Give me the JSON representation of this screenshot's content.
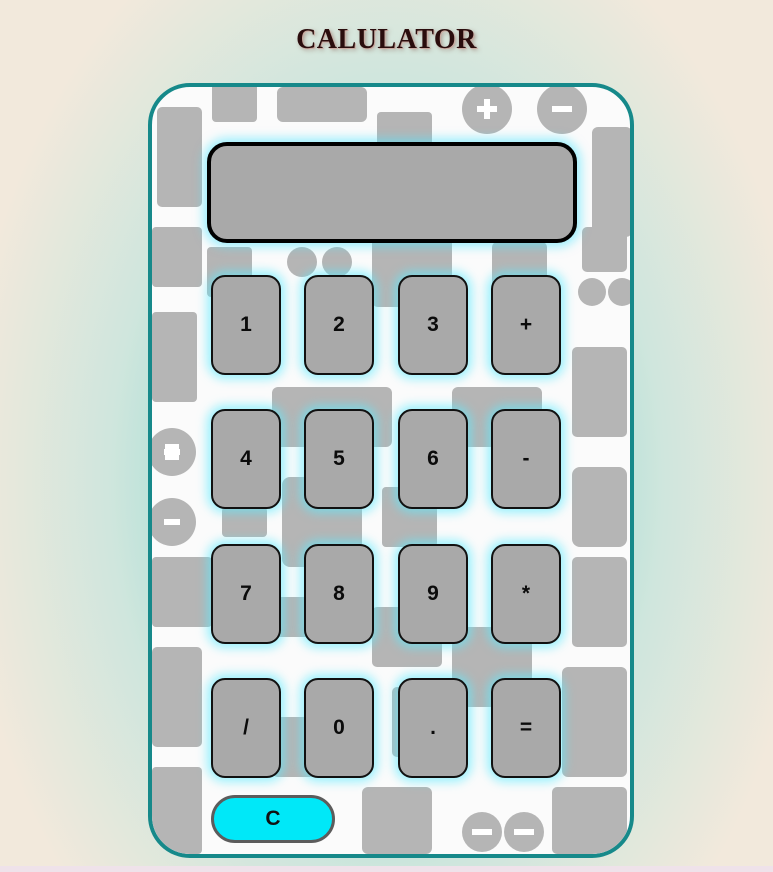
{
  "page": {
    "title": "CALULATOR"
  },
  "display": {
    "value": ""
  },
  "keys": [
    [
      "1",
      "2",
      "3",
      "+"
    ],
    [
      "4",
      "5",
      "6",
      "-"
    ],
    [
      "7",
      "8",
      "9",
      "*"
    ],
    [
      "/",
      "0",
      ".",
      "="
    ]
  ],
  "clear_label": "C",
  "colors": {
    "frame": "#16898a",
    "key_bg": "#a9a9a9",
    "display_bg": "#a9a9a9",
    "clear_bg": "#00e8f8",
    "glow": "#5aebff"
  }
}
